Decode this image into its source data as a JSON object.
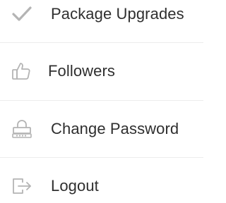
{
  "menu": {
    "items": [
      {
        "label": "Package Upgrades",
        "icon": "checkmark-icon"
      },
      {
        "label": "Followers",
        "icon": "thumbs-up-icon"
      },
      {
        "label": "Change Password",
        "icon": "lock-password-icon"
      },
      {
        "label": "Logout",
        "icon": "logout-icon"
      }
    ]
  },
  "colors": {
    "text": "#2f2f2f",
    "icon": "#b4b4b4",
    "divider": "#ececec",
    "background": "#ffffff"
  }
}
